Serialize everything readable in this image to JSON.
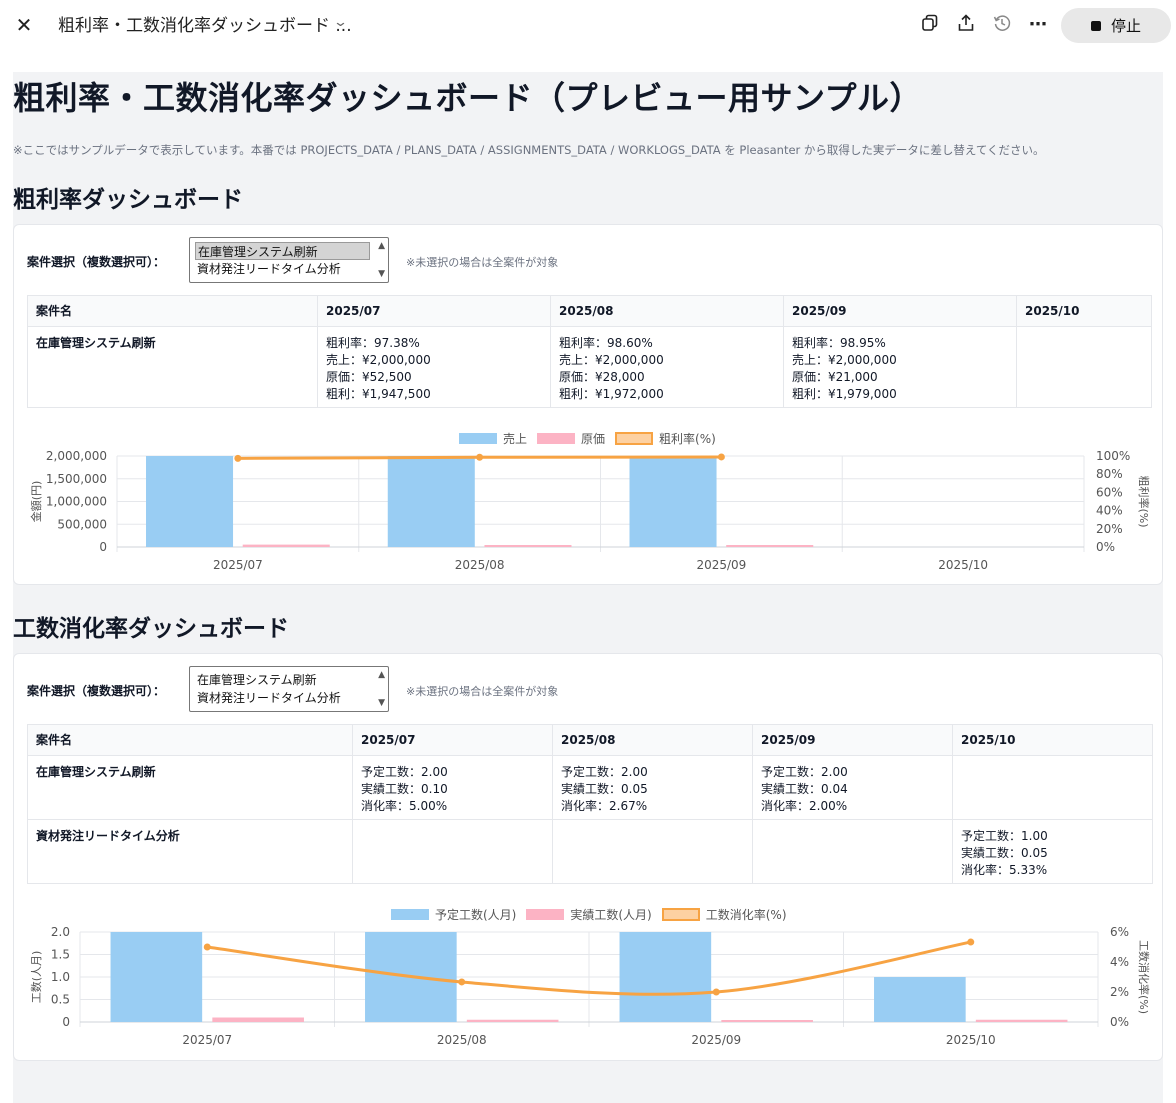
{
  "topbar": {
    "title": "粗利率・工数消化率ダッシュボード ...",
    "stop_label": "停止"
  },
  "page": {
    "heading": "粗利率・工数消化率ダッシュボード（プレビュー用サンプル）",
    "note": "※ここではサンプルデータで表示しています。本番では PROJECTS_DATA / PLANS_DATA / ASSIGNMENTS_DATA / WORKLOGS_DATA を Pleasanter から取得した実データに差し替えてください。"
  },
  "icons": [
    "close-icon",
    "chevron-down-icon",
    "copy-icon",
    "share-icon",
    "history-icon",
    "more-icon",
    "stop-icon"
  ],
  "profit": {
    "heading": "粗利率ダッシュボード",
    "select_label": "案件選択（複数選択可）：",
    "options": [
      "在庫管理システム刷新",
      "資材発注リードタイム分析"
    ],
    "selected_index": 0,
    "hint": "※未選択の場合は全案件が対象",
    "columns": [
      "案件名",
      "2025/07",
      "2025/08",
      "2025/09",
      "2025/10"
    ],
    "rows": [
      {
        "name": "在庫管理システム刷新",
        "cells": [
          [
            "粗利率：97.38%",
            "売上：¥2,000,000",
            "原価：¥52,500",
            "粗利：¥1,947,500"
          ],
          [
            "粗利率：98.60%",
            "売上：¥2,000,000",
            "原価：¥28,000",
            "粗利：¥1,972,000"
          ],
          [
            "粗利率：98.95%",
            "売上：¥2,000,000",
            "原価：¥21,000",
            "粗利：¥1,979,000"
          ],
          []
        ]
      }
    ]
  },
  "effort": {
    "heading": "工数消化率ダッシュボード",
    "select_label": "案件選択（複数選択可）：",
    "options": [
      "在庫管理システム刷新",
      "資材発注リードタイム分析"
    ],
    "hint": "※未選択の場合は全案件が対象",
    "columns": [
      "案件名",
      "2025/07",
      "2025/08",
      "2025/09",
      "2025/10"
    ],
    "rows": [
      {
        "name": "在庫管理システム刷新",
        "cells": [
          [
            "予定工数：2.00",
            "実績工数：0.10",
            "消化率：5.00%"
          ],
          [
            "予定工数：2.00",
            "実績工数：0.05",
            "消化率：2.67%"
          ],
          [
            "予定工数：2.00",
            "実績工数：0.04",
            "消化率：2.00%"
          ],
          []
        ]
      },
      {
        "name": "資材発注リードタイム分析",
        "cells": [
          [],
          [],
          [],
          [
            "予定工数：1.00",
            "実績工数：0.05",
            "消化率：5.33%"
          ]
        ]
      }
    ]
  },
  "chart_data": [
    {
      "type": "bar",
      "categories": [
        "2025/07",
        "2025/08",
        "2025/09",
        "2025/10"
      ],
      "series": [
        {
          "name": "売上",
          "kind": "bar",
          "axis": "left",
          "color": "#99cdf3",
          "values": [
            2000000,
            2000000,
            2000000,
            0
          ]
        },
        {
          "name": "原価",
          "kind": "bar",
          "axis": "left",
          "color": "#fcb3c4",
          "values": [
            52500,
            28000,
            21000,
            0
          ]
        },
        {
          "name": "粗利率(%)",
          "kind": "line",
          "axis": "right",
          "color": "#f7a343",
          "values": [
            97.38,
            98.6,
            98.95,
            null
          ]
        }
      ],
      "ylabel": "金額(円)",
      "y2label": "粗利率(%)",
      "ylim": [
        0,
        2000000
      ],
      "yticks": [
        "2,000,000",
        "1,500,000",
        "1,000,000",
        "500,000",
        "0"
      ],
      "y2lim": [
        0,
        100
      ],
      "y2ticks": [
        "100%",
        "80%",
        "60%",
        "40%",
        "20%",
        "0%"
      ],
      "legend": "top-center",
      "grid": true
    },
    {
      "type": "bar",
      "categories": [
        "2025/07",
        "2025/08",
        "2025/09",
        "2025/10"
      ],
      "series": [
        {
          "name": "予定工数(人月)",
          "kind": "bar",
          "axis": "left",
          "color": "#99cdf3",
          "values": [
            2.0,
            2.0,
            2.0,
            1.0
          ]
        },
        {
          "name": "実績工数(人月)",
          "kind": "bar",
          "axis": "left",
          "color": "#fcb3c4",
          "values": [
            0.1,
            0.05,
            0.04,
            0.05
          ]
        },
        {
          "name": "工数消化率(%)",
          "kind": "line",
          "axis": "right",
          "color": "#f7a343",
          "values": [
            5.0,
            2.67,
            2.0,
            5.33
          ]
        }
      ],
      "ylabel": "工数(人月)",
      "y2label": "工数消化率(%)",
      "ylim": [
        0,
        2.0
      ],
      "yticks": [
        "2.0",
        "1.5",
        "1.0",
        "0.5",
        "0"
      ],
      "y2lim": [
        0,
        6
      ],
      "y2ticks": [
        "6%",
        "4%",
        "2%",
        "0%"
      ],
      "legend": "top-center",
      "grid": true
    }
  ]
}
